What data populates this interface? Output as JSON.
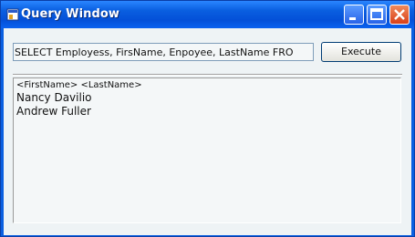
{
  "window": {
    "title": "Query Window",
    "titlebar_color": "#0a5fe0"
  },
  "query": {
    "value": "SELECT Employess, FirsName, Enpoyee, LastName FRO"
  },
  "toolbar": {
    "execute_label": "Execute"
  },
  "results": {
    "header": "<FirstName>  <LastName>",
    "rows": [
      "Nancy Davilio",
      "Andrew Fuller"
    ]
  },
  "icons": {
    "app": "app-window-icon",
    "minimize": "minimize-icon",
    "maximize": "maximize-icon",
    "close": "close-icon"
  }
}
